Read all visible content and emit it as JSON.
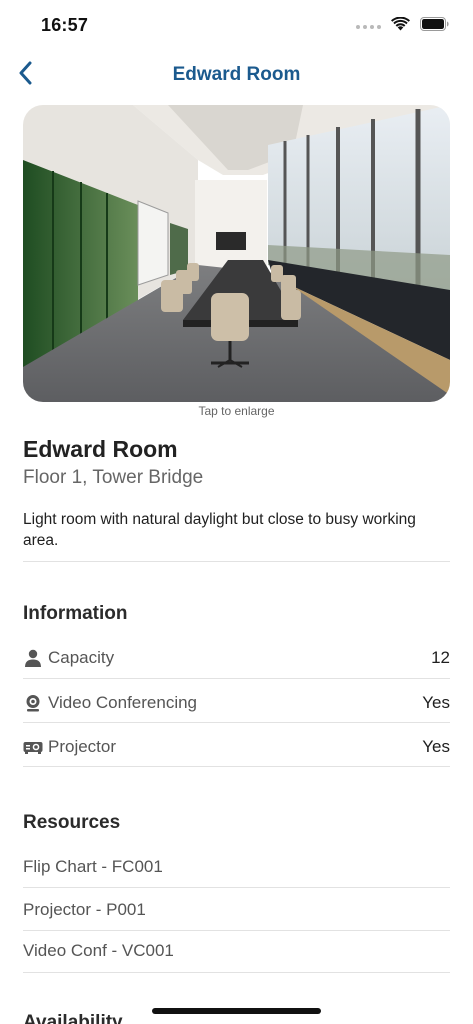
{
  "status_bar": {
    "time": "16:57"
  },
  "nav": {
    "title": "Edward Room",
    "back_icon": "chevron-left-icon"
  },
  "photo": {
    "hint": "Tap to enlarge"
  },
  "room": {
    "name": "Edward Room",
    "location": "Floor 1, Tower Bridge",
    "description": "Light room with natural daylight but close to busy working area."
  },
  "information": {
    "title": "Information",
    "rows": [
      {
        "label": "Capacity",
        "value": "12",
        "icon": "person-icon"
      },
      {
        "label": "Video Conferencing",
        "value": "Yes",
        "icon": "webcam-icon"
      },
      {
        "label": "Projector",
        "value": "Yes",
        "icon": "projector-icon"
      }
    ]
  },
  "resources": {
    "title": "Resources",
    "items": [
      "Flip Chart - FC001",
      "Projector - P001",
      "Video Conf - VC001"
    ]
  },
  "availability": {
    "title": "Availability"
  },
  "colors": {
    "accent": "#1b5a8e",
    "divider": "#e2e2e2",
    "muted_text": "#666666"
  }
}
